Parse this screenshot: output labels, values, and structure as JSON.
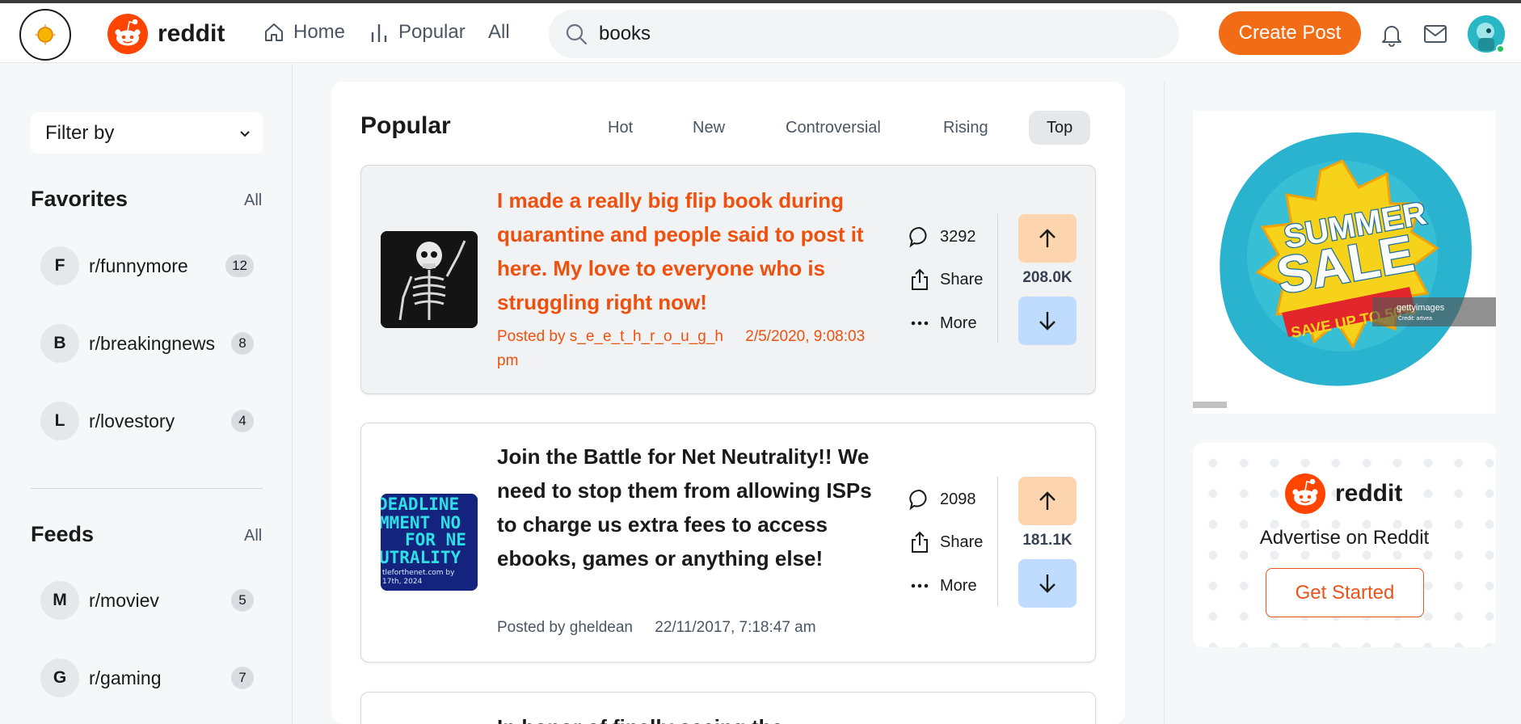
{
  "header": {
    "logo_text": "reddit",
    "nav": {
      "home": "Home",
      "popular": "Popular",
      "all": "All"
    },
    "search": {
      "value": "books"
    },
    "create_post": "Create Post"
  },
  "sidebar": {
    "filter_label": "Filter by",
    "favorites": {
      "title": "Favorites",
      "all_label": "All",
      "items": [
        {
          "letter": "F",
          "name": "r/funnymore",
          "count": "12"
        },
        {
          "letter": "B",
          "name": "r/breakingnews",
          "count": "8"
        },
        {
          "letter": "L",
          "name": "r/lovestory",
          "count": "4"
        }
      ]
    },
    "feeds": {
      "title": "Feeds",
      "all_label": "All",
      "items": [
        {
          "letter": "M",
          "name": "r/moviev",
          "count": "5"
        },
        {
          "letter": "G",
          "name": "r/gaming",
          "count": "7"
        }
      ]
    }
  },
  "feed": {
    "title": "Popular",
    "tabs": [
      "Hot",
      "New",
      "Controversial",
      "Rising",
      "Top"
    ],
    "active_tab": "Top",
    "posts": [
      {
        "title": "I made a really big flip book during quarantine and people said to post it here. My love to everyone who is struggling right now!",
        "posted_by_prefix": "Posted by",
        "author": "s_e_e_t_h_r_o_u_g_h",
        "date": "2/5/2020, 9:08:03 pm",
        "comments": "3292",
        "share_label": "Share",
        "more_label": "More",
        "votes": "208.0K",
        "highlighted": true
      },
      {
        "title": "Join the Battle for Net Neutrality!! We need to stop them from allowing ISPs to charge us extra fees to access ebooks, games or anything else!",
        "posted_by_prefix": "Posted by",
        "author": "gheldean",
        "date": "22/11/2017, 7:18:47 am",
        "comments": "2098",
        "share_label": "Share",
        "more_label": "More",
        "votes": "181.1K",
        "thumb_text": "DEADLINE\nMMENT NO\nFOR NE\nUTRALITY\ntleforthenet.com by\n17th, 2024",
        "highlighted": false
      },
      {
        "title": "In honor of finally seeing the"
      }
    ]
  },
  "right": {
    "ad_image": {
      "text_line1": "SUMMER",
      "text_line2": "SALE",
      "banner": "SAVE UP TO 50%",
      "watermark": "gettyimages"
    },
    "ad_card": {
      "logo_text": "reddit",
      "text": "Advertise on Reddit",
      "button": "Get Started"
    }
  },
  "colors": {
    "accent": "#f26c16",
    "highlight_text": "#f0500d",
    "upvote_bg": "#fcd5ae",
    "downvote_bg": "#bfdbfe"
  }
}
